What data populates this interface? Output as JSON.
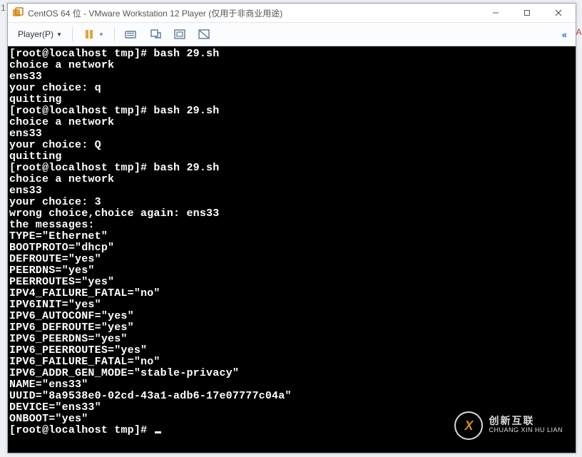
{
  "gutter_left": "1",
  "gutter_right": "A",
  "titlebar": {
    "title": "CentOS 64 位 - VMware Workstation 12 Player (仅用于非商业用途)"
  },
  "toolbar": {
    "player_label": "Player(P)",
    "dropdown": "▼"
  },
  "terminal": {
    "lines": [
      "[root@localhost tmp]# bash 29.sh",
      "choice a network",
      "ens33",
      "your choice: q",
      "quitting",
      "[root@localhost tmp]# bash 29.sh",
      "choice a network",
      "ens33",
      "your choice: Q",
      "quitting",
      "[root@localhost tmp]# bash 29.sh",
      "choice a network",
      "ens33",
      "your choice: 3",
      "wrong choice,choice again: ens33",
      "the messages:",
      "TYPE=\"Ethernet\"",
      "BOOTPROTO=\"dhcp\"",
      "DEFROUTE=\"yes\"",
      "PEERDNS=\"yes\"",
      "PEERROUTES=\"yes\"",
      "IPV4_FAILURE_FATAL=\"no\"",
      "IPV6INIT=\"yes\"",
      "IPV6_AUTOCONF=\"yes\"",
      "IPV6_DEFROUTE=\"yes\"",
      "IPV6_PEERDNS=\"yes\"",
      "IPV6_PEERROUTES=\"yes\"",
      "IPV6_FAILURE_FATAL=\"no\"",
      "IPV6_ADDR_GEN_MODE=\"stable-privacy\"",
      "NAME=\"ens33\"",
      "UUID=\"8a9538e0-02cd-43a1-adb6-17e07777c04a\"",
      "DEVICE=\"ens33\"",
      "ONBOOT=\"yes\""
    ],
    "prompt_tail": "[root@localhost tmp]# "
  },
  "watermark": {
    "logo_letter": "X",
    "cn": "创新互联",
    "py": "CHUANG XIN HU LIAN"
  }
}
